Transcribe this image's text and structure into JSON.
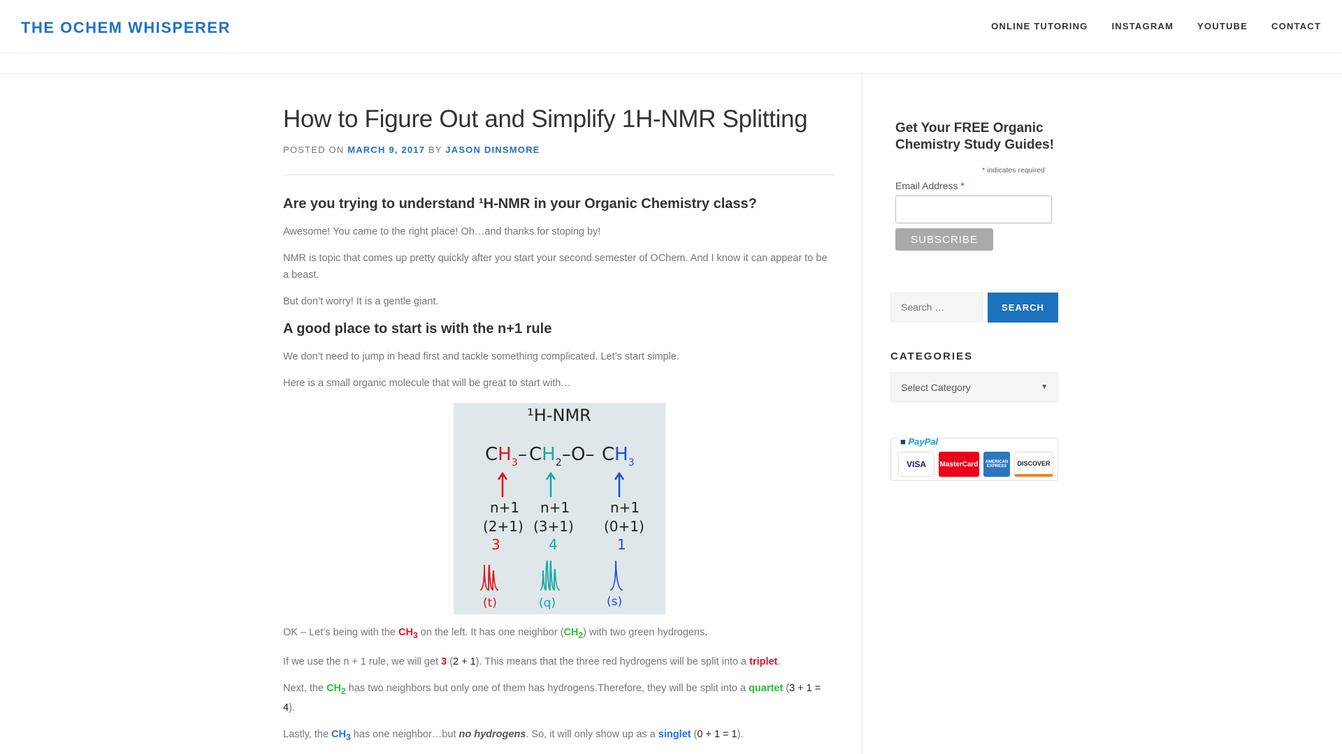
{
  "header": {
    "brand": "THE OCHEM WHISPERER",
    "nav": [
      "ONLINE TUTORING",
      "INSTAGRAM",
      "YOUTUBE",
      "CONTACT"
    ]
  },
  "post": {
    "title": "How to Figure Out and Simplify 1H-NMR Splitting",
    "meta_posted": "POSTED ON",
    "meta_date": "MARCH 9, 2017",
    "meta_by": "BY",
    "meta_author": "JASON DINSMORE",
    "h3_1": "Are you trying to understand ¹H-NMR in your Organic Chemistry class?",
    "p1": "Awesome! You came to the right place! Oh…and thanks for stoping by!",
    "p2": "NMR is topic that comes up pretty quickly after you start your second semester of OChem. And I know it can appear to be a beast.",
    "p3": "But don’t worry! It is a gentle giant.",
    "h3_2": "A good place to start is with the n+1 rule",
    "p4": "We don’t need to jump in head first and tackle something complicated. Let’s start simple.",
    "p5": "Here is a small organic molecule that will be great to start with…",
    "figure": {
      "title": "¹H-NMR",
      "formula": [
        "CH3",
        "CH2",
        "O",
        "CH3"
      ],
      "labels": [
        "n+1",
        "n+1",
        "n+1"
      ],
      "calcs": [
        "(2+1)",
        "(3+1)",
        "(0+1)"
      ],
      "counts": [
        "3",
        "4",
        "1"
      ],
      "kinds": [
        "(t)",
        "(q)",
        "(s)"
      ]
    },
    "p6": {
      "a": "OK – Let’s being with the ",
      "b": "CH",
      "b_sub": "3",
      "c": " on the left. It has one neighbor (",
      "d": "CH",
      "d_sub": "2",
      "e": ") with two green hydrogens",
      "f": "."
    },
    "p7": {
      "a": "If we use the n + 1 rule, we will get ",
      "b": "3",
      "c": " (",
      "d": "2 + 1",
      "e": "). This means that the three red hydrogens will be split into a ",
      "f": "triplet",
      "g": "."
    },
    "p8": {
      "a": "Next, the ",
      "b": "CH",
      "b_sub": "2",
      "c": " has two neighbors but only one of them has hydrogens.Therefore, they will be split into a ",
      "d": "quartet",
      "e": " (",
      "f": "3 + 1 = 4",
      "g": ")."
    },
    "p9": {
      "a": "Lastly, the ",
      "b": "CH",
      "b_sub": "3",
      "c": " has one neighbor…but ",
      "d": "no hydrogens",
      "e": ". So, it will only show up as a ",
      "f": "singlet",
      "g": " (",
      "h": "0 + 1 = 1",
      "i": ")."
    }
  },
  "sidebar": {
    "signup_title": "Get Your FREE Organic Chemistry Study Guides!",
    "required_asterisk": "*",
    "required_note": " indicates required",
    "email_label": "Email Address ",
    "email_asterisk": "*",
    "subscribe": "SUBSCRIBE",
    "search_placeholder": "Search …",
    "search_button": "SEARCH",
    "categories_title": "CATEGORIES",
    "category_select": "Select Category",
    "paypal": "PayPal",
    "cards": [
      "VISA",
      "MasterCard",
      "AMERICAN EXPRESS",
      "DISCOVER"
    ]
  },
  "colors": {
    "accent": "#1e73be",
    "red": "#e0141e",
    "green": "#22c22e",
    "blue": "#1a73e8"
  }
}
